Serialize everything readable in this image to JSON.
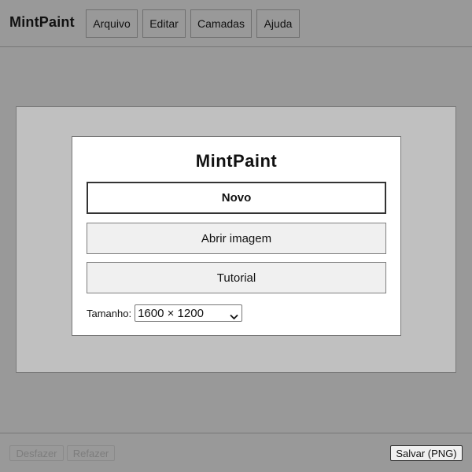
{
  "app": {
    "title": "MintPaint"
  },
  "menu": {
    "items": [
      {
        "label": "Arquivo"
      },
      {
        "label": "Editar"
      },
      {
        "label": "Camadas"
      },
      {
        "label": "Ajuda"
      }
    ]
  },
  "dialog": {
    "title": "MintPaint",
    "new_label": "Novo",
    "open_label": "Abrir imagem",
    "tutorial_label": "Tutorial",
    "size_label": "Tamanho:",
    "size_selected": "1600 × 1200"
  },
  "bottombar": {
    "undo_label": "Desfazer",
    "undo_enabled": false,
    "redo_label": "Refazer",
    "redo_enabled": false,
    "save_label": "Salvar (PNG)"
  },
  "icons": {
    "size_select_arrow": "chevron-down-icon"
  },
  "colors": {
    "workspace_bg": "#999999",
    "canvas_bg": "#c0c0c0",
    "dialog_bg": "#ffffff",
    "button_bg": "#f0f0f0",
    "disabled_text": "#7d7d7d"
  }
}
